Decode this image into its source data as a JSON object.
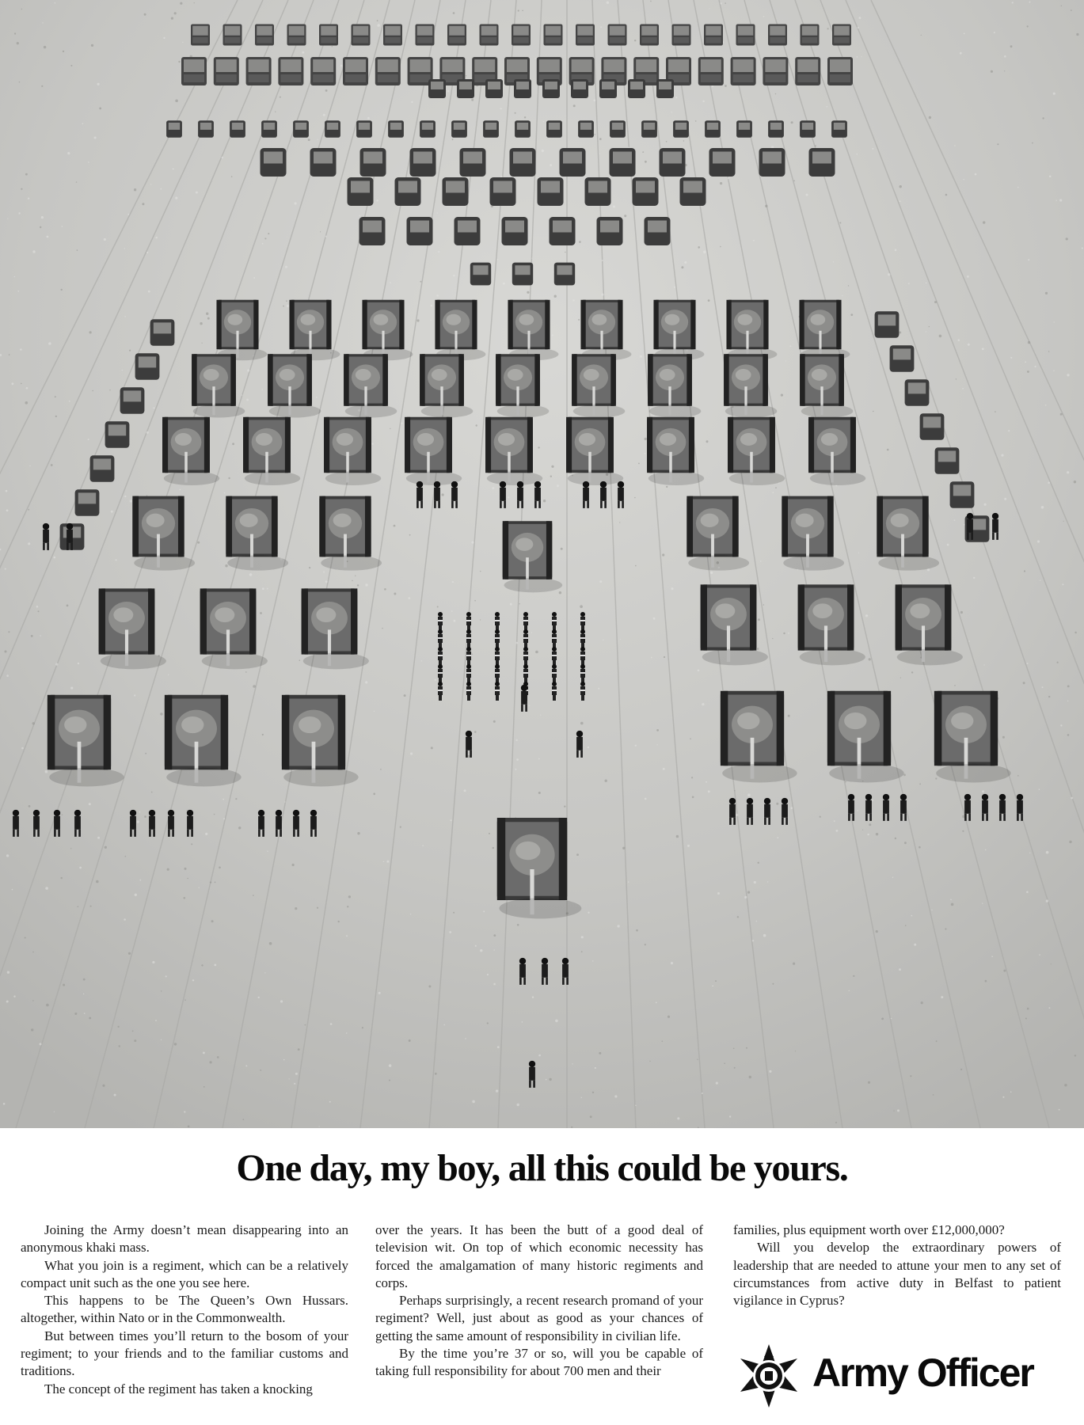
{
  "headline": "One day, my boy, all this could be yours.",
  "body": {
    "col1": [
      "Joining the Army doesn’t mean disappearing into an anonymous khaki mass.",
      "What you join is a regiment, which can be a relatively compact unit such as the one you see here.",
      "This happens to be The Queen’s Own Hussars. altogether, within Nato or in the Commonwealth.",
      "But between times you’ll return to the bosom of your regiment; to your friends and to the familiar customs and traditions.",
      "The concept of the regiment has taken a knocking"
    ],
    "col2": [
      "over the years. It has been the butt of a good deal of television wit. On top of which economic necessity has forced the amalgamation of many historic regiments and corps.",
      "Perhaps surprisingly, a recent research promand of your regiment? Well, just about as good as your chances of getting the same amount of responsibility in civilian life.",
      "By the time you’re 37 or so, will you be capable of taking full responsibility for about 700 men and their"
    ],
    "col3": [
      "families, plus equipment worth over £12,000,000?",
      "Will you develop the extraordinary powers of leadership that are needed to attune your men to any set of circumstances from active duty in Belfast to patient vigilance in Cyprus?"
    ]
  },
  "brand": {
    "name": "Army Officer",
    "crest_icon": "army-crest-icon"
  },
  "photo": {
    "icon": "tank-formation-photo"
  },
  "colors": {
    "ink": "#0a0a0a",
    "paper": "#ffffff",
    "field": "#c9c9c6"
  }
}
